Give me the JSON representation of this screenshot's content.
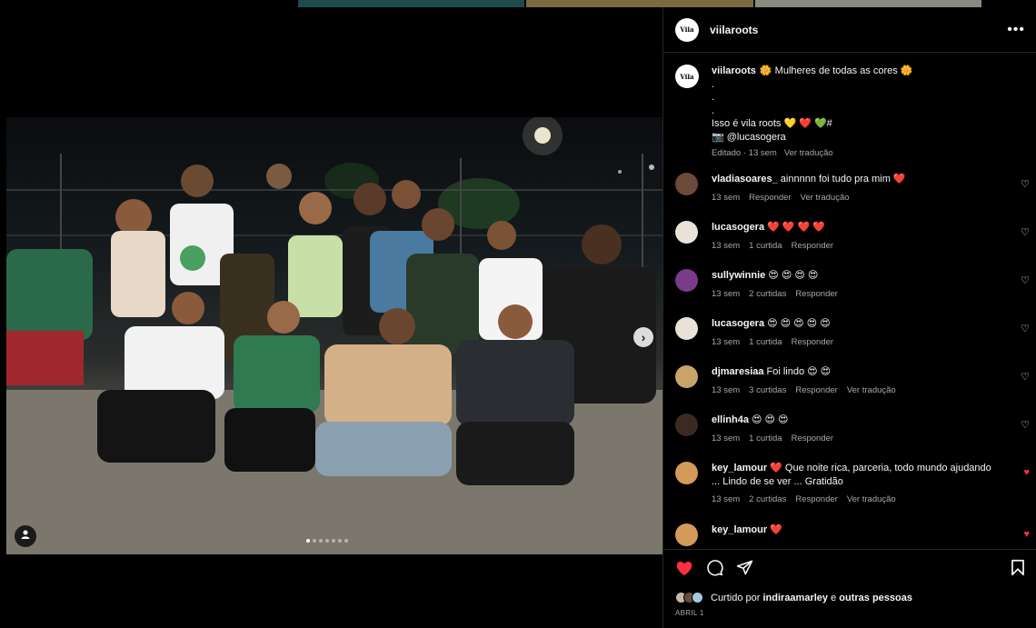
{
  "post": {
    "username": "viilaroots",
    "more_icon": "more-horizontal-icon"
  },
  "caption": {
    "username": "viilaroots",
    "line1": "🌼 Mulheres de todas as cores 🌼",
    "dot1": ".",
    "dot2": ".",
    "dot3": ".",
    "line2": "Isso é vila roots 💛 ❤️ 💚#",
    "line3": "📷 @lucasogera",
    "edited": "Editado · 13 sem",
    "translate": "Ver tradução"
  },
  "comments": [
    {
      "user": "vladiasoares_",
      "text": "ainnnnn foi tudo pra mim ❤️",
      "time": "13 sem",
      "likes": "",
      "reply": "Responder",
      "translate": "Ver tradução",
      "liked": false,
      "avatar_color": "#6b4a3a"
    },
    {
      "user": "lucasogera",
      "text": "❤️ ❤️ ❤️ ❤️",
      "time": "13 sem",
      "likes": "1 curtida",
      "reply": "Responder",
      "translate": "",
      "liked": false,
      "avatar_color": "#e8e2d8"
    },
    {
      "user": "sullywinnie",
      "text": "😍 😍 😍 😍",
      "time": "13 sem",
      "likes": "2 curtidas",
      "reply": "Responder",
      "translate": "",
      "liked": false,
      "avatar_color": "#7a3b8a"
    },
    {
      "user": "lucasogera",
      "text": "😍 😍 😍 😍 😍",
      "time": "13 sem",
      "likes": "1 curtida",
      "reply": "Responder",
      "translate": "",
      "liked": false,
      "avatar_color": "#e8e2d8"
    },
    {
      "user": "djmaresiaa",
      "text": "Foi lindo 😍 😍",
      "time": "13 sem",
      "likes": "3 curtidas",
      "reply": "Responder",
      "translate": "Ver tradução",
      "liked": false,
      "avatar_color": "#c9a46a"
    },
    {
      "user": "ellinh4a",
      "text": "😍 😍 😍",
      "time": "13 sem",
      "likes": "1 curtida",
      "reply": "Responder",
      "translate": "",
      "liked": false,
      "avatar_color": "#3a2a22"
    },
    {
      "user": "key_lamour",
      "text": "❤️ Que noite rica, parceria, todo mundo ajudando ... Lindo de se ver ... Gratidão",
      "time": "13 sem",
      "likes": "2 curtidas",
      "reply": "Responder",
      "translate": "Ver tradução",
      "liked": true,
      "avatar_color": "#d49a5a"
    },
    {
      "user": "key_lamour",
      "text": "❤️",
      "time": "",
      "likes": "",
      "reply": "",
      "translate": "",
      "liked": true,
      "avatar_color": "#d49a5a"
    }
  ],
  "likes": {
    "prefix": "Curtido por",
    "user": "indiraamarley",
    "suffix": "e",
    "others": "outras pessoas"
  },
  "date": "ABRIL 1",
  "carousel": {
    "slides": 7,
    "active": 0
  },
  "colors": {
    "like_red": "#ff3040",
    "bg": "#000000",
    "muted": "#a8a8a8",
    "border": "#262626"
  }
}
